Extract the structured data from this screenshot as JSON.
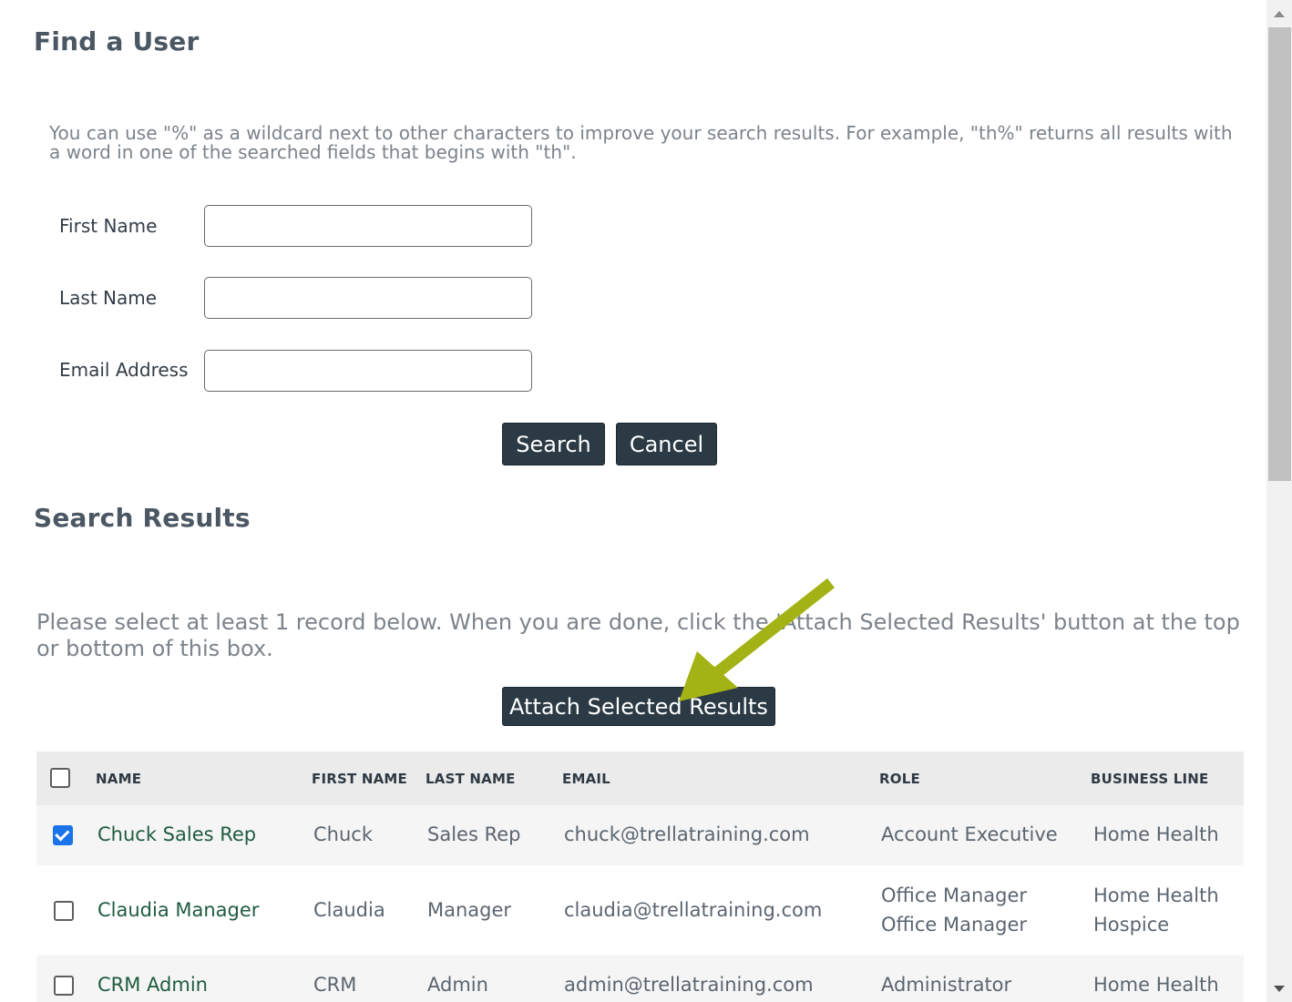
{
  "find_user": {
    "title": "Find a User",
    "hint": "You can use \"%\" as a wildcard next to other characters to improve your search results. For example, \"th%\" returns all results with a word in one of the searched fields that begins with \"th\".",
    "fields": [
      {
        "label": "First Name",
        "value": ""
      },
      {
        "label": "Last Name",
        "value": ""
      },
      {
        "label": "Email Address",
        "value": ""
      }
    ],
    "search_label": "Search",
    "cancel_label": "Cancel"
  },
  "results": {
    "title": "Search Results",
    "hint": "Please select at least 1 record below. When you are done, click the 'Attach Selected Results' button at the top or bottom of this box.",
    "attach_label": "Attach Selected Results",
    "columns": [
      "NAME",
      "FIRST NAME",
      "LAST NAME",
      "EMAIL",
      "ROLE",
      "BUSINESS LINE"
    ],
    "rows": [
      {
        "checked": true,
        "name": "Chuck Sales Rep",
        "first": "Chuck",
        "last": "Sales Rep",
        "email": "chuck@trellatraining.com",
        "role": [
          "Account Executive"
        ],
        "business_line": [
          "Home Health"
        ]
      },
      {
        "checked": false,
        "name": "Claudia Manager",
        "first": "Claudia",
        "last": "Manager",
        "email": "claudia@trellatraining.com",
        "role": [
          "Office Manager",
          "Office Manager"
        ],
        "business_line": [
          "Home Health",
          "Hospice"
        ]
      },
      {
        "checked": false,
        "name": "CRM Admin",
        "first": "CRM",
        "last": "Admin",
        "email": "admin@trellatraining.com",
        "role": [
          "Administrator"
        ],
        "business_line": [
          "Home Health"
        ]
      }
    ]
  },
  "colors": {
    "button_bg": "#2b3a44",
    "link_green": "#1f5c3f",
    "annotation_arrow": "#a3b214",
    "checkbox_checked": "#1a73e8"
  }
}
